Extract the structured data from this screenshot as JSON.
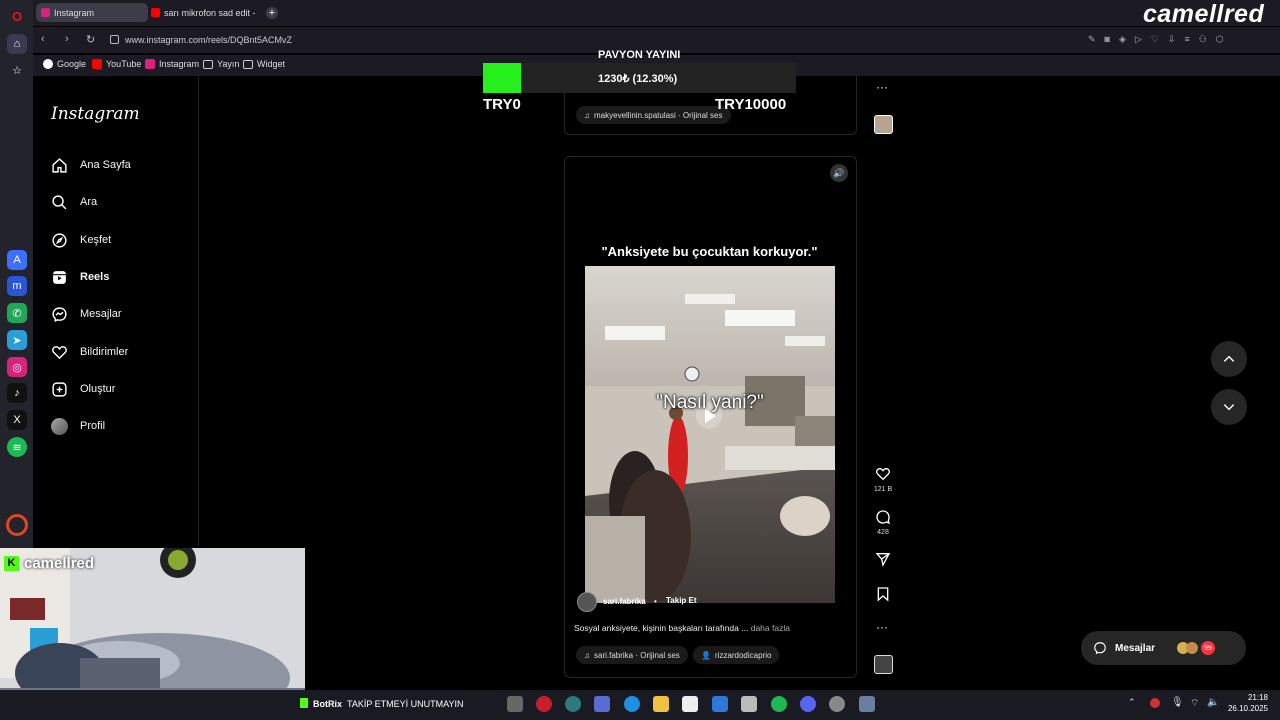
{
  "browser": {
    "tabs": [
      {
        "label": "Instagram",
        "active": true
      },
      {
        "label": "sarı mikrofon sad edit - Yo",
        "active": false
      }
    ],
    "new_tab_symbol": "+",
    "url": "www.instagram.com/reels/DQBnt5ACMvZ",
    "bookmarks": [
      "Google",
      "YouTube",
      "Instagram",
      "Yayın",
      "Widget"
    ]
  },
  "stream_overlay": {
    "brand": "camellred",
    "donation": {
      "title": "PAVYON YAYINI",
      "current_label": "1230₺ (12.30%)",
      "progress_percent": 12.3,
      "min_label": "TRY0",
      "max_label": "TRY10000"
    },
    "kick_username": "camellred",
    "botrix_label": "BotRix",
    "ticker_text": "TAKİP ETMEYİ UNUTMAYIN"
  },
  "instagram": {
    "logo": "Instagram",
    "nav": [
      {
        "label": "Ana Sayfa",
        "icon": "home-icon"
      },
      {
        "label": "Ara",
        "icon": "search-icon"
      },
      {
        "label": "Keşfet",
        "icon": "compass-icon"
      },
      {
        "label": "Reels",
        "icon": "reels-icon",
        "active": true
      },
      {
        "label": "Mesajlar",
        "icon": "messenger-icon"
      },
      {
        "label": "Bildirimler",
        "icon": "heart-icon"
      },
      {
        "label": "Oluştur",
        "icon": "plus-icon"
      },
      {
        "label": "Profil",
        "icon": "avatar-icon"
      }
    ],
    "prev_reel": {
      "audio_label": "makyevellinin.spatulasi · Orijinal ses"
    },
    "reel": {
      "caption_title": "\"Anksiyete bu çocuktan korkuyor.\"",
      "video_subtitle": "\"Nasıl yani?\"",
      "username": "sari.fabrika",
      "separator": "•",
      "follow_label": "Takip Et",
      "description": "Sosyal anksiyete, kişinin başkaları tarafında ...",
      "more_label": "daha fazla",
      "audio_label": "sari.fabrika · Orijinal ses",
      "tagged_user": "rizzardodicaprio",
      "likes": "121 B",
      "comments": "428"
    },
    "messages_button": "Mesajlar",
    "messages_badge": "99"
  },
  "taskbar": {
    "time": "21:18",
    "date": "26.10.2025"
  }
}
